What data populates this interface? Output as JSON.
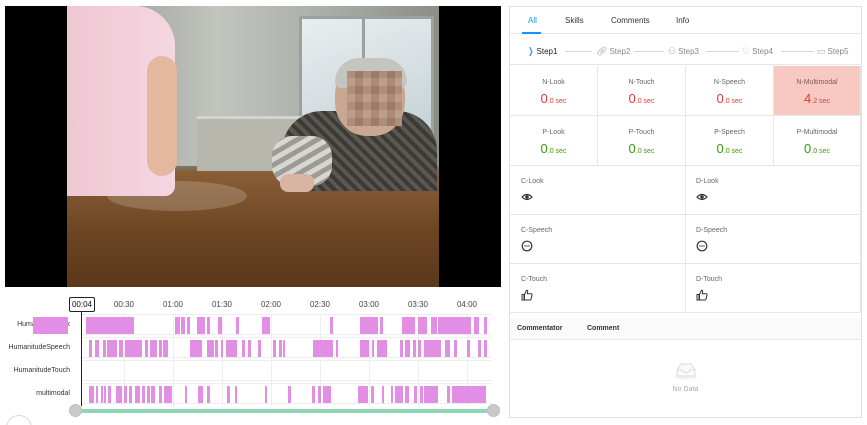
{
  "tabs": [
    {
      "label": "All",
      "active": true
    },
    {
      "label": "Skills",
      "active": false
    },
    {
      "label": "Comments",
      "active": false
    },
    {
      "label": "Info",
      "active": false
    }
  ],
  "steps": [
    {
      "label": "Step1",
      "icon": "chevron-icon",
      "active": true
    },
    {
      "label": "Step2",
      "icon": "link-icon",
      "active": false
    },
    {
      "label": "Step3",
      "icon": "users-icon",
      "active": false
    },
    {
      "label": "Step4",
      "icon": "heart-icon",
      "active": false
    },
    {
      "label": "Step5",
      "icon": "calendar-icon",
      "active": false
    }
  ],
  "metrics": {
    "n_look": {
      "title": "N-Look",
      "value": "0",
      "unit": ".0 sec"
    },
    "n_touch": {
      "title": "N-Touch",
      "value": "0",
      "unit": ".0 sec"
    },
    "n_speech": {
      "title": "N-Speech",
      "value": "0",
      "unit": ".0 sec"
    },
    "n_multimodal": {
      "title": "N-Multimodal",
      "value": "4",
      "unit": ".2 sec",
      "highlight_color": "#f8c9c2"
    },
    "p_look": {
      "title": "P-Look",
      "value": "0",
      "unit": ".0 sec"
    },
    "p_touch": {
      "title": "P-Touch",
      "value": "0",
      "unit": ".0 sec"
    },
    "p_speech": {
      "title": "P-Speech",
      "value": "0",
      "unit": ".0 sec"
    },
    "p_multimodal": {
      "title": "P-Multimodal",
      "value": "0",
      "unit": ".0 sec"
    }
  },
  "cd_items": {
    "c_look": {
      "title": "C-Look",
      "icon": "eye-icon"
    },
    "d_look": {
      "title": "D-Look",
      "icon": "eye-icon"
    },
    "c_speech": {
      "title": "C-Speech",
      "icon": "speech-bubble-icon"
    },
    "d_speech": {
      "title": "D-Speech",
      "icon": "speech-bubble-icon"
    },
    "c_touch": {
      "title": "C-Touch",
      "icon": "thumbs-up-icon"
    },
    "d_touch": {
      "title": "D-Touch",
      "icon": "thumbs-up-icon"
    }
  },
  "comments": {
    "col_commentator": "Commentator",
    "col_comment": "Comment",
    "empty_text": "No Data"
  },
  "timeline": {
    "current_time": "00:04",
    "ticks": [
      "00:30",
      "01:00",
      "01:30",
      "02:00",
      "02:30",
      "03:00",
      "03:30",
      "04:00"
    ],
    "rows": [
      "HumanitudeLook",
      "HumanitudeSpeech",
      "HumanitudeTouch",
      "multimodal"
    ],
    "segment_color": "#e28ee4",
    "slider_color": "#8fd6b6"
  }
}
